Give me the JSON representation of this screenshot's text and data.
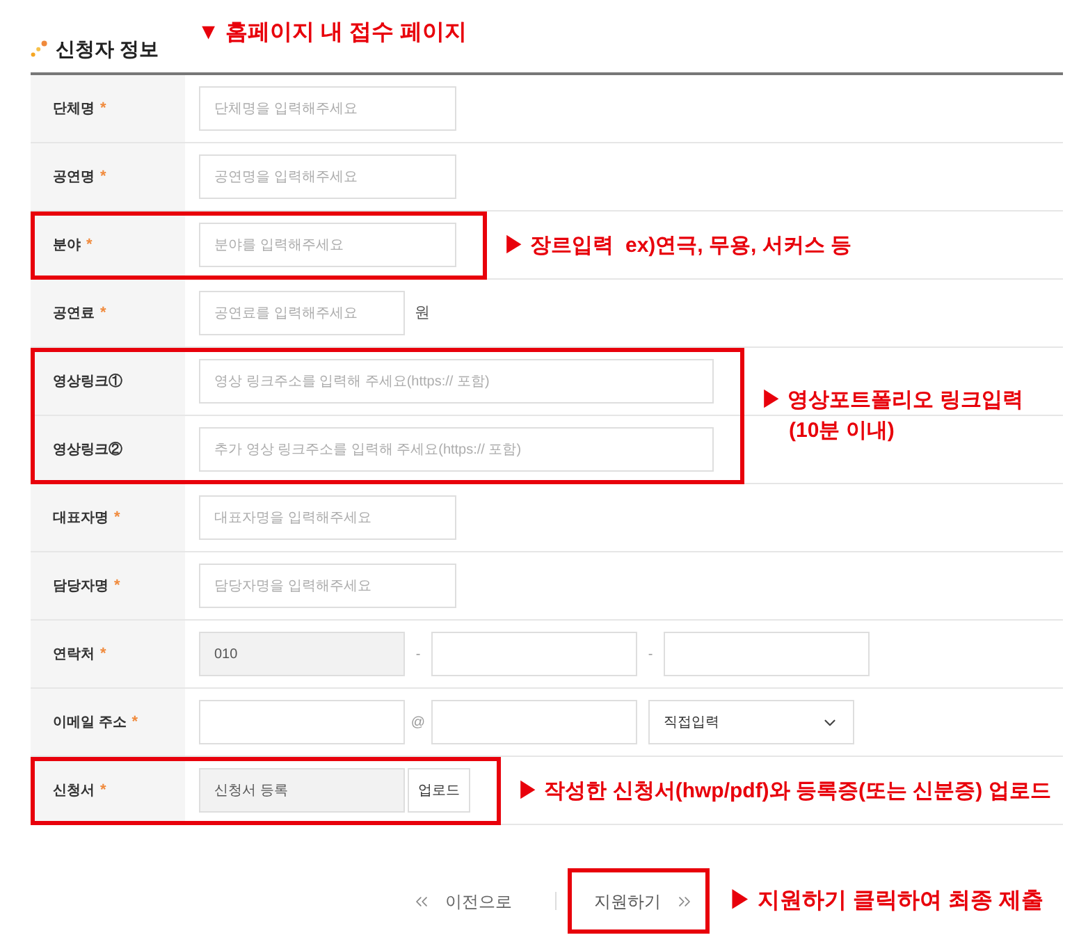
{
  "header": {
    "title": "신청자 정보",
    "note": "▼ 홈페이지 내 접수 페이지"
  },
  "groups": [
    {
      "highlighted": false,
      "rows": [
        {
          "label": "단체명",
          "mark": "*",
          "parts": [
            {
              "kind": "input",
              "placeholder": "단체명을 입력해주세요",
              "readonly": false
            }
          ]
        },
        {
          "label": "공연명",
          "mark": "*",
          "parts": [
            {
              "kind": "input",
              "placeholder": "공연명을 입력해주세요",
              "readonly": false
            }
          ]
        }
      ]
    },
    {
      "highlighted": true,
      "note": "▶ 장르입력  ex)연극, 무용, 서커스 등",
      "rows": [
        {
          "label": "분야",
          "mark": "*",
          "parts": [
            {
              "kind": "input",
              "placeholder": "분야를 입력해주세요",
              "readonly": false
            }
          ]
        }
      ]
    },
    {
      "highlighted": false,
      "rows": [
        {
          "label": "공연료",
          "mark": "*",
          "parts": [
            {
              "kind": "short_input",
              "placeholder": "공연료를 입력해주세요",
              "readonly": false
            },
            {
              "kind": "text",
              "text": "원"
            }
          ]
        }
      ]
    },
    {
      "highlighted": true,
      "note": "▶ 영상포트폴리오 링크입력 (10분 이내)",
      "rows": [
        {
          "label": "영상링크①",
          "parts": [
            {
              "kind": "long_input",
              "placeholder": "영상 링크주소를 입력해 주세요(https:// 포함)",
              "readonly": false
            }
          ]
        },
        {
          "label": "영상링크②",
          "parts": [
            {
              "kind": "long_input",
              "placeholder": "추가 영상 링크주소를 입력해 주세요(https:// 포함)",
              "readonly": false
            }
          ]
        }
      ]
    },
    {
      "highlighted": false,
      "rows": [
        {
          "label": "대표자명",
          "mark": "*",
          "parts": [
            {
              "kind": "input",
              "placeholder": "대표자명을 입력해주세요",
              "readonly": false
            }
          ]
        },
        {
          "label": "담당자명",
          "mark": "*",
          "parts": [
            {
              "kind": "input",
              "placeholder": "담당자명을 입력해주세요",
              "readonly": false
            }
          ]
        },
        {
          "label": "연락처",
          "mark": "*",
          "parts": [
            {
              "kind": "short_input",
              "value": "010",
              "readonly": true
            },
            {
              "kind": "separator",
              "text": "-"
            },
            {
              "kind": "short_input",
              "readonly": false
            },
            {
              "kind": "separator",
              "text": "-"
            },
            {
              "kind": "short_input",
              "readonly": false
            }
          ]
        },
        {
          "label": "이메일 주소",
          "mark": "*",
          "parts": [
            {
              "kind": "short_input",
              "readonly": false
            },
            {
              "kind": "separator",
              "text": "@"
            },
            {
              "kind": "short_input",
              "readonly": false
            },
            {
              "kind": "select",
              "value": "직접입력"
            }
          ]
        }
      ]
    },
    {
      "highlighted": true,
      "note": "▶ 작성한 신청서(hwp/pdf)와 등록증(또는 신분증) 업로드",
      "rows": [
        {
          "label": "신청서",
          "mark": "*",
          "parts": [
            {
              "kind": "short_input",
              "value": "신청서 등록",
              "readonly": true
            },
            {
              "kind": "button",
              "label": "업로드"
            }
          ]
        }
      ]
    }
  ],
  "nav": {
    "previous": {
      "label": "이전으로"
    },
    "submit": {
      "label": "지원하기",
      "highlighted": true,
      "note": "▶ 지원하기 클릭하여 최종 제출"
    }
  }
}
